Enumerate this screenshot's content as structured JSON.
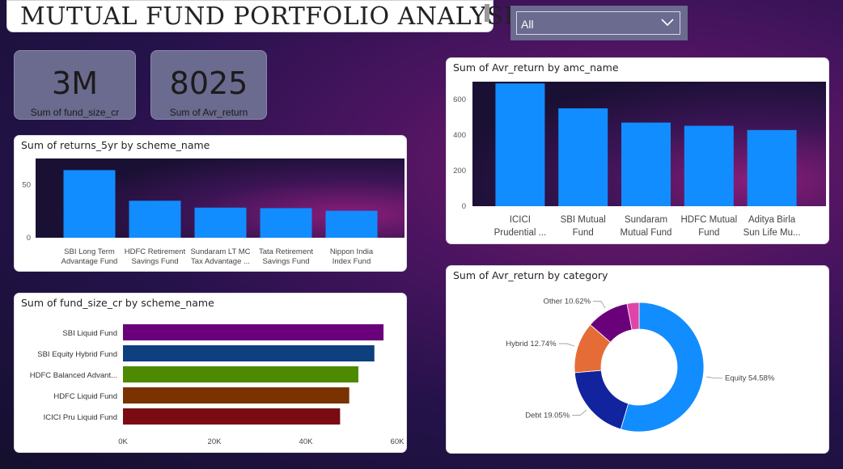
{
  "header": {
    "title": "MUTUAL FUND PORTFOLIO ANALYSIS"
  },
  "slicer": {
    "value": "All",
    "icon": "chevron-down-icon"
  },
  "kpis": [
    {
      "value": "3M",
      "label": "Sum of fund_size_cr"
    },
    {
      "value": "8025",
      "label": "Sum of Avr_return"
    }
  ],
  "colors": {
    "bar_blue": "#118dff",
    "equity": "#118dff",
    "debt": "#12239e",
    "hybrid": "#e66c37",
    "other": "#6b007b",
    "pink": "#e044a7"
  },
  "chart_data": [
    {
      "id": "returns5yr",
      "type": "bar",
      "title": "Sum of returns_5yr by scheme_name",
      "categories": [
        [
          "SBI Long Term",
          "Advantage Fund"
        ],
        [
          "HDFC Retirement",
          "Savings Fund"
        ],
        [
          "Sundaram LT MC",
          "Tax Advantage ..."
        ],
        [
          "Tata Retirement",
          "Savings Fund"
        ],
        [
          "Nippon India",
          "Index Fund"
        ]
      ],
      "values": [
        64,
        35,
        28.5,
        28,
        25.5
      ],
      "ylim": [
        0,
        75
      ],
      "yticks": [
        "0",
        "50"
      ],
      "ytick_values": [
        0,
        50
      ],
      "xlabel": "",
      "ylabel": ""
    },
    {
      "id": "amc",
      "type": "bar",
      "title": "Sum of Avr_return by amc_name",
      "categories": [
        [
          "ICICI",
          "Prudential ..."
        ],
        [
          "SBI Mutual",
          "Fund"
        ],
        [
          "Sundaram",
          "Mutual Fund"
        ],
        [
          "HDFC Mutual",
          "Fund"
        ],
        [
          "Aditya Birla",
          "Sun Life Mu..."
        ]
      ],
      "values": [
        690,
        550,
        470,
        452,
        428
      ],
      "ylim": [
        0,
        700
      ],
      "yticks": [
        "0",
        "200",
        "400",
        "600"
      ],
      "ytick_values": [
        0,
        200,
        400,
        600
      ],
      "xlabel": "",
      "ylabel": ""
    },
    {
      "id": "fundsize",
      "type": "bar",
      "orientation": "horizontal",
      "title": "Sum of fund_size_cr by scheme_name",
      "categories": [
        "SBI Liquid Fund",
        "SBI Equity Hybrid Fund",
        "HDFC Balanced Advant...",
        "HDFC Liquid Fund",
        "ICICI Pru Liquid Fund"
      ],
      "values": [
        57000,
        55000,
        51500,
        49500,
        47500
      ],
      "bar_colors": [
        "#6b007b",
        "#0e3f7e",
        "#4d8a00",
        "#7a3200",
        "#7a0b14"
      ],
      "xlim": [
        0,
        60000
      ],
      "xticks": [
        "0K",
        "20K",
        "40K",
        "60K"
      ],
      "xtick_values": [
        0,
        20000,
        40000,
        60000
      ],
      "xlabel": "",
      "ylabel": ""
    },
    {
      "id": "category",
      "type": "pie",
      "donut": true,
      "title": "Sum of Avr_return by category",
      "slices": [
        {
          "name": "Equity",
          "pct_label": "54.58%",
          "value": 54.58,
          "color": "#118dff"
        },
        {
          "name": "Debt",
          "pct_label": "19.05%",
          "value": 19.05,
          "color": "#12239e"
        },
        {
          "name": "Hybrid",
          "pct_label": "12.74%",
          "value": 12.74,
          "color": "#e66c37"
        },
        {
          "name": "Other",
          "pct_label": "10.62%",
          "value": 10.62,
          "color": "#6b007b"
        },
        {
          "name": "",
          "pct_label": "",
          "value": 3.01,
          "color": "#e044a7"
        }
      ]
    }
  ]
}
